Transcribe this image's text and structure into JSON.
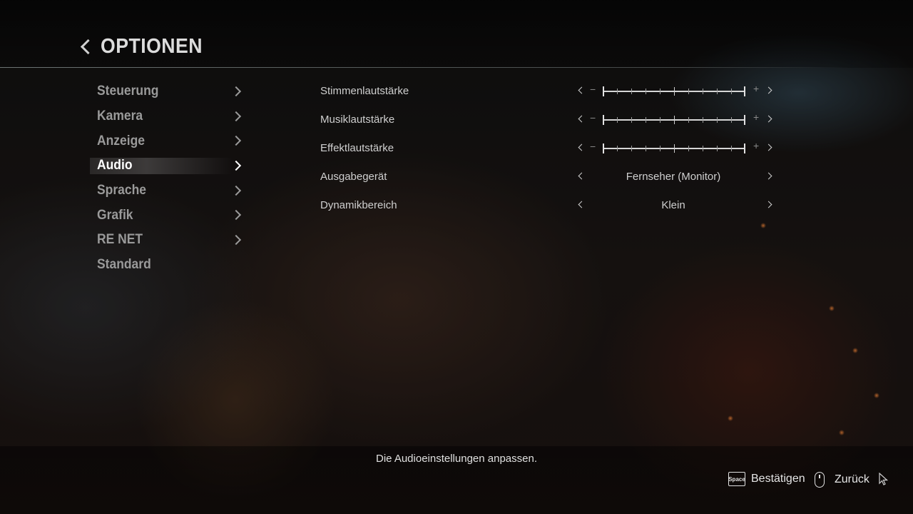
{
  "header": {
    "title": "OPTIONEN"
  },
  "menu": {
    "items": [
      {
        "label": "Steuerung",
        "active": false
      },
      {
        "label": "Kamera",
        "active": false
      },
      {
        "label": "Anzeige",
        "active": false
      },
      {
        "label": "Audio",
        "active": true
      },
      {
        "label": "Sprache",
        "active": false
      },
      {
        "label": "Grafik",
        "active": false
      },
      {
        "label": "RE NET",
        "active": false
      },
      {
        "label": "Standard",
        "active": false
      }
    ]
  },
  "settings": {
    "voice_volume": {
      "label": "Stimmenlautstärke",
      "minus": "−",
      "plus": "+",
      "level": 1.0
    },
    "music_volume": {
      "label": "Musiklautstärke",
      "minus": "−",
      "plus": "+",
      "level": 1.0
    },
    "effect_volume": {
      "label": "Effektlautstärke",
      "minus": "−",
      "plus": "+",
      "level": 1.0
    },
    "output_device": {
      "label": "Ausgabegerät",
      "value": "Fernseher (Monitor)"
    },
    "dynamic_range": {
      "label": "Dynamikbereich",
      "value": "Klein"
    }
  },
  "footer": {
    "description": "Die Audioeinstellungen anpassen.",
    "confirm_key": "Space",
    "confirm_label": "Bestätigen",
    "back_label": "Zurück"
  }
}
